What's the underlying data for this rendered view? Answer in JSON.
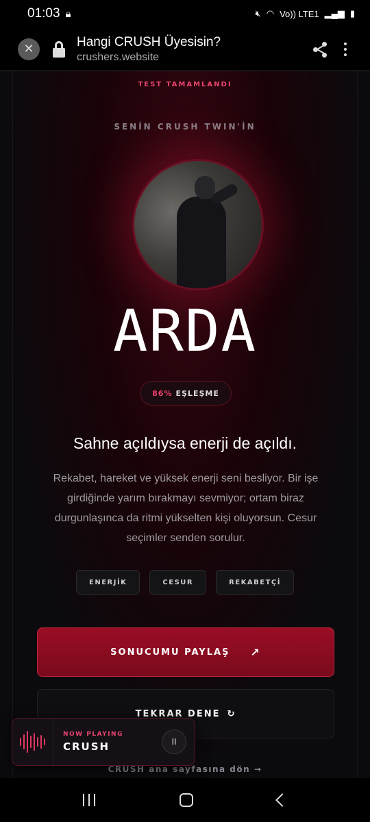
{
  "status": {
    "time": "01:03",
    "network": "Vo)) LTE1"
  },
  "browser": {
    "title": "Hangi CRUSH Üyesisin?",
    "url": "crushers.website"
  },
  "result": {
    "test_done": "TEST TAMAMLANDI",
    "twin_label": "SENİN CRUSH TWIN'İN",
    "name": "ARDA",
    "match_percent": "86%",
    "match_label": "EŞLEŞME",
    "headline": "Sahne açıldıysa enerji de açıldı.",
    "description": "Rekabet, hareket ve yüksek enerji seni besliyor. Bir işe girdiğinde yarım bırakmayı sevmiyor; ortam biraz durgunlaşınca da ritmi yükselten kişi oluyorsun. Cesur seçimler senden sorulur.",
    "tags": [
      "ENERJİK",
      "CESUR",
      "REKABETÇİ"
    ]
  },
  "actions": {
    "share": "SONUCUMU PAYLAŞ",
    "share_icon": "↗",
    "retry": "TEKRAR DENE",
    "retry_icon": "↻",
    "home_link": "CRUSH ana sayfasına dön →"
  },
  "player": {
    "now_playing": "NOW PLAYING",
    "track": "CRUSH",
    "pause_icon": "II"
  },
  "colors": {
    "accent": "#e8456e",
    "button": "#9a0d25"
  }
}
